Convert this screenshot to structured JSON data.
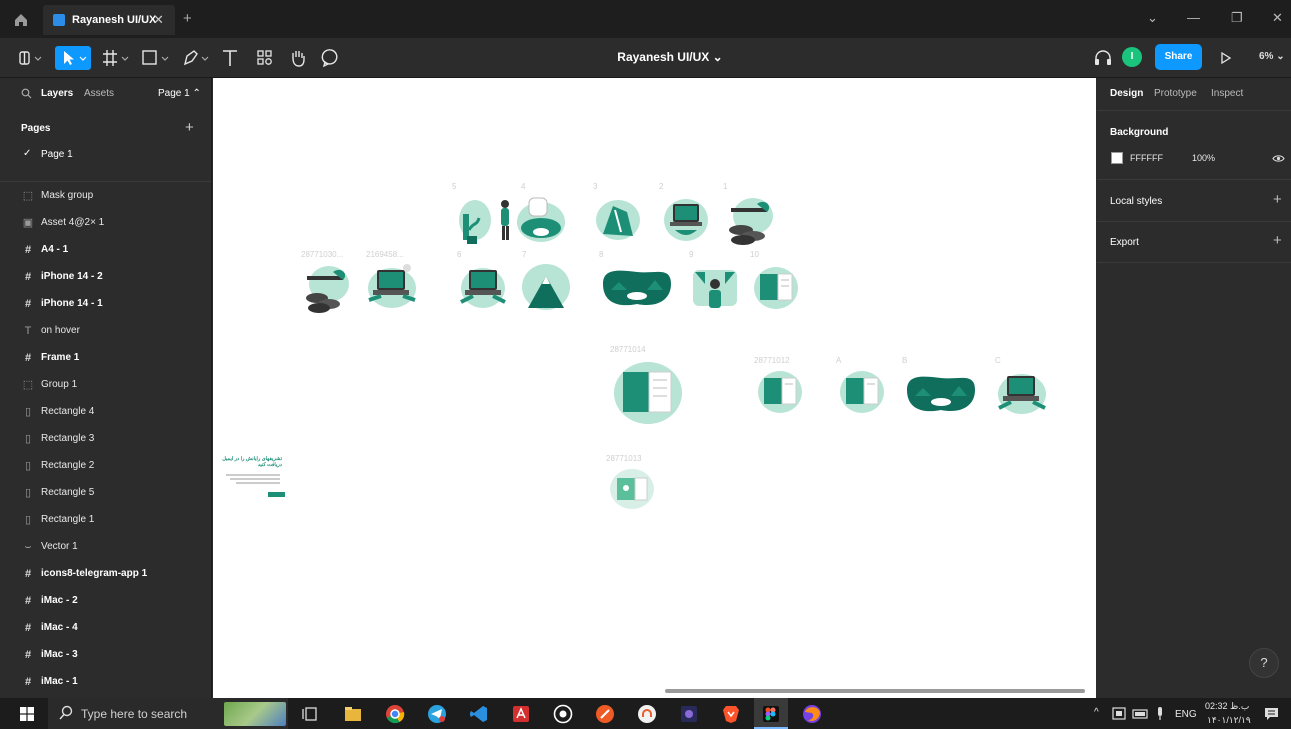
{
  "tabbar": {
    "tab_title": "Rayanesh UI/UX",
    "close": "✕",
    "add": "+",
    "minimize": "—",
    "restore": "❐",
    "close_window": "✕",
    "more": "⌄"
  },
  "toolbar": {
    "doc_title": "Rayanesh UI/UX ⌄",
    "share_label": "Share",
    "avatar_initial": "I",
    "zoom_label": "6% ⌄"
  },
  "left_panel": {
    "tabs": {
      "layers": "Layers",
      "assets": "Assets",
      "page": "Page 1 ⌃"
    },
    "pages_heading": "Pages",
    "pages_add": "+",
    "pages": [
      {
        "name": "Page 1",
        "check": "✓"
      }
    ],
    "layers": [
      {
        "name": "Mask group",
        "type": "group"
      },
      {
        "name": "Asset 4@2× 1",
        "type": "image"
      },
      {
        "name": "A4 - 1",
        "type": "frame"
      },
      {
        "name": "iPhone 14 - 2",
        "type": "frame"
      },
      {
        "name": "iPhone 14 - 1",
        "type": "frame"
      },
      {
        "name": "on hover",
        "type": "text"
      },
      {
        "name": "Frame 1",
        "type": "frame"
      },
      {
        "name": "Group 1",
        "type": "group"
      },
      {
        "name": "Rectangle 4",
        "type": "rect"
      },
      {
        "name": "Rectangle 3",
        "type": "rect"
      },
      {
        "name": "Rectangle 2",
        "type": "rect"
      },
      {
        "name": "Rectangle 5",
        "type": "rect"
      },
      {
        "name": "Rectangle 1",
        "type": "rect"
      },
      {
        "name": "Vector 1",
        "type": "vector"
      },
      {
        "name": "icons8-telegram-app 1",
        "type": "frame"
      },
      {
        "name": "iMac - 2",
        "type": "frame"
      },
      {
        "name": "iMac - 4",
        "type": "frame"
      },
      {
        "name": "iMac - 3",
        "type": "frame"
      },
      {
        "name": "iMac - 1",
        "type": "frame"
      }
    ]
  },
  "canvas": {
    "labels": {
      "row1": [
        "5",
        "4",
        "3",
        "2",
        "1"
      ],
      "row2": [
        "28771030...",
        "2169458...",
        "6",
        "7",
        "8",
        "9",
        "10"
      ],
      "row3": [
        "28771014",
        "28771012",
        "A",
        "B",
        "C"
      ],
      "row4": [
        "28771013"
      ]
    },
    "card_title": "تشریفهای رایانش را در ایمیل دریافت کنید"
  },
  "right_panel": {
    "tabs": {
      "design": "Design",
      "prototype": "Prototype",
      "inspect": "Inspect"
    },
    "background_heading": "Background",
    "background_hex": "FFFFFF",
    "background_opacity": "100%",
    "local_styles": "Local styles",
    "export": "Export",
    "plus": "+"
  },
  "help_label": "?",
  "taskbar": {
    "search_placeholder": "Type here to search",
    "lang": "ENG",
    "time": "02:32 ب.ظ",
    "date": "۱۴۰۱/۱۲/۱۹"
  },
  "colors": {
    "accent": "#0d99ff",
    "teal": "#1e8f77",
    "mint": "#b7e4d4",
    "dark_teal": "#0f6f5c"
  }
}
